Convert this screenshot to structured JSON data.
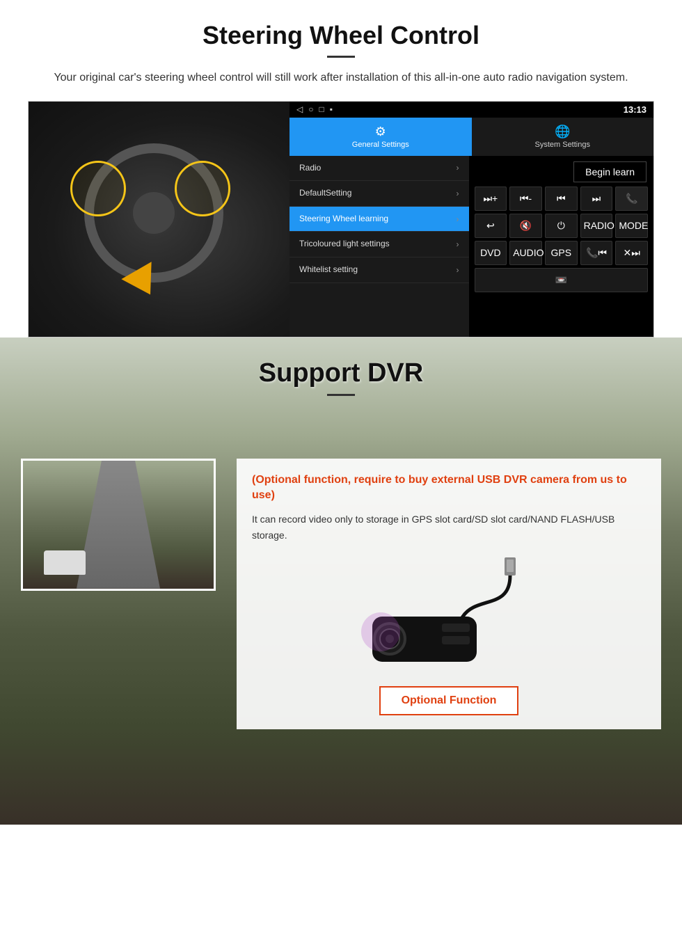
{
  "steering": {
    "title": "Steering Wheel Control",
    "description": "Your original car's steering wheel control will still work after installation of this all-in-one auto radio navigation system.",
    "android": {
      "time": "13:13",
      "tabs": {
        "general": "General Settings",
        "system": "System Settings"
      },
      "menu": [
        {
          "label": "Radio",
          "active": false
        },
        {
          "label": "DefaultSetting",
          "active": false
        },
        {
          "label": "Steering Wheel learning",
          "active": true
        },
        {
          "label": "Tricoloured light settings",
          "active": false
        },
        {
          "label": "Whitelist setting",
          "active": false
        }
      ],
      "begin_learn": "Begin learn",
      "buttons_row1": [
        "⏭+",
        "⏮-",
        "⏮⏮",
        "⏭⏭",
        "📞"
      ],
      "buttons_row2": [
        "↩",
        "🔇x",
        "⏻",
        "RADIO",
        "MODE"
      ],
      "buttons_row3": [
        "DVD",
        "AUDIO",
        "GPS",
        "📞⏮",
        "✕⏭"
      ],
      "buttons_row4_icon": "📼"
    }
  },
  "dvr": {
    "title": "Support DVR",
    "optional_title": "(Optional function, require to buy external USB DVR camera from us to use)",
    "description": "It can record video only to storage in GPS slot card/SD slot card/NAND FLASH/USB storage.",
    "optional_func_label": "Optional Function"
  }
}
